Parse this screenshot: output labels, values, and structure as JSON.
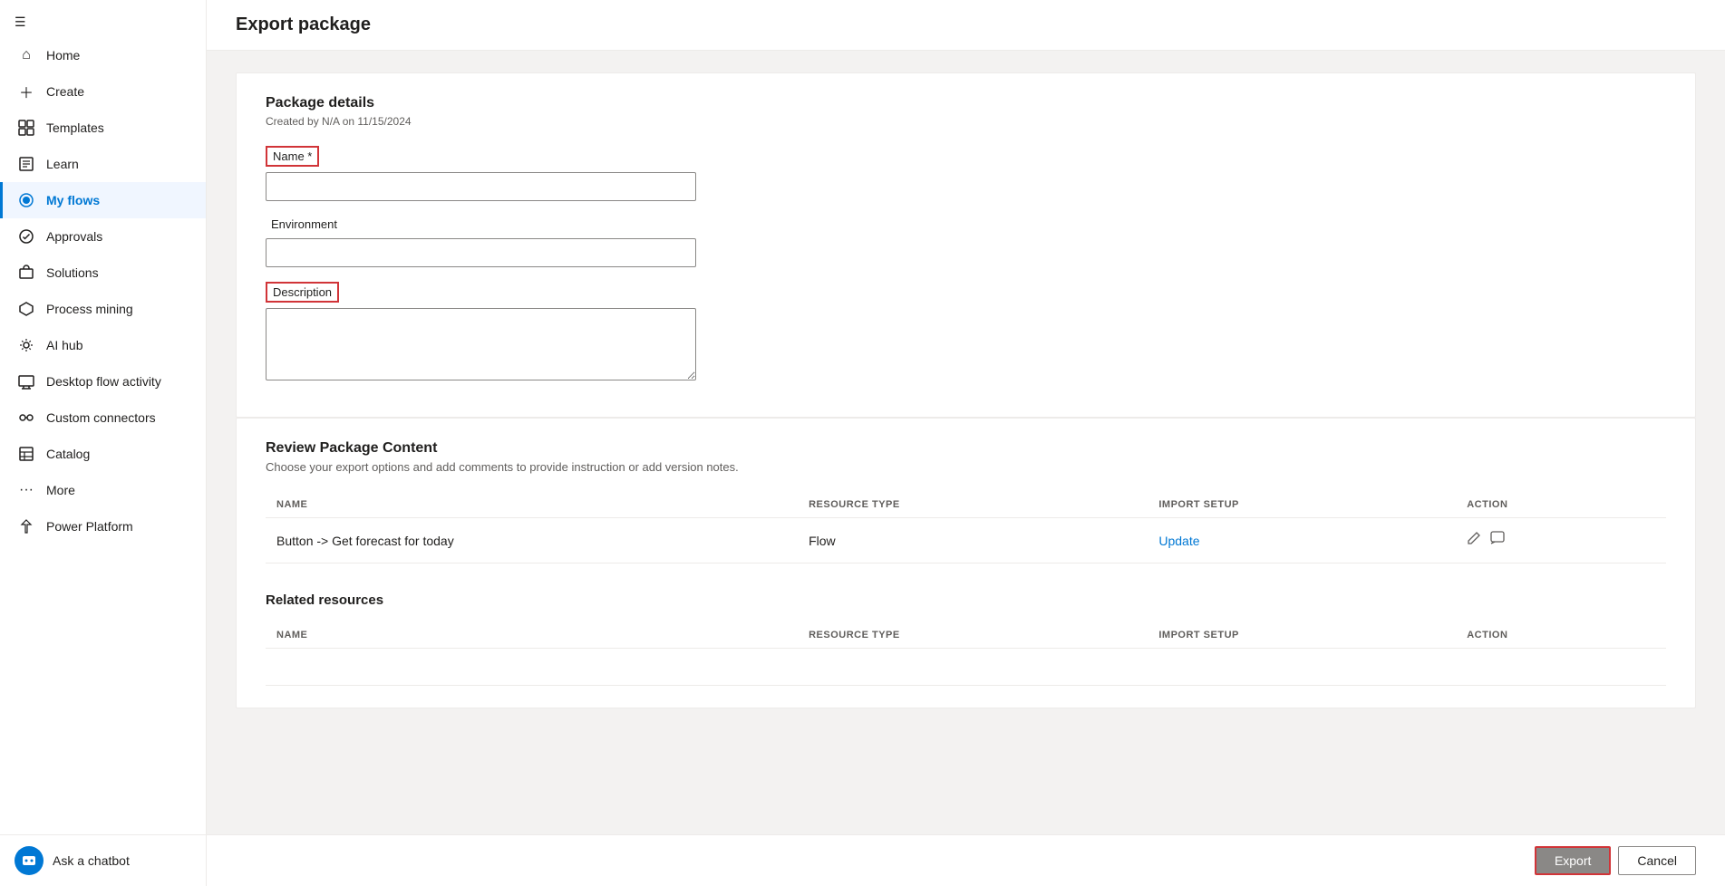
{
  "sidebar": {
    "hamburger_icon": "☰",
    "items": [
      {
        "id": "home",
        "label": "Home",
        "icon": "⌂",
        "active": false
      },
      {
        "id": "create",
        "label": "Create",
        "icon": "+",
        "active": false
      },
      {
        "id": "templates",
        "label": "Templates",
        "icon": "📄",
        "active": false
      },
      {
        "id": "learn",
        "label": "Learn",
        "icon": "📖",
        "active": false
      },
      {
        "id": "my-flows",
        "label": "My flows",
        "icon": "💧",
        "active": true
      },
      {
        "id": "approvals",
        "label": "Approvals",
        "icon": "✅",
        "active": false
      },
      {
        "id": "solutions",
        "label": "Solutions",
        "icon": "🧩",
        "active": false
      },
      {
        "id": "process-mining",
        "label": "Process mining",
        "icon": "⬡",
        "active": false
      },
      {
        "id": "ai-hub",
        "label": "AI hub",
        "icon": "🤖",
        "active": false
      },
      {
        "id": "desktop-flow-activity",
        "label": "Desktop flow activity",
        "icon": "🖥",
        "active": false
      },
      {
        "id": "custom-connectors",
        "label": "Custom connectors",
        "icon": "🔌",
        "active": false
      },
      {
        "id": "catalog",
        "label": "Catalog",
        "icon": "📚",
        "active": false
      },
      {
        "id": "more",
        "label": "More",
        "icon": "···",
        "active": false
      },
      {
        "id": "power-platform",
        "label": "Power Platform",
        "icon": "⚡",
        "active": false
      }
    ],
    "chatbot_label": "Ask a chatbot",
    "chatbot_icon": "💬"
  },
  "page": {
    "title": "Export package"
  },
  "package_details": {
    "section_title": "Package details",
    "subtitle": "Created by N/A on 11/15/2024",
    "name_label": "Name *",
    "name_placeholder": "",
    "name_value": "",
    "environment_label": "Environment",
    "environment_placeholder": "",
    "environment_value": "",
    "description_label": "Description",
    "description_placeholder": "",
    "description_value": ""
  },
  "review_package": {
    "section_title": "Review Package Content",
    "description": "Choose your export options and add comments to provide instruction or add version notes.",
    "table_headers": {
      "name": "NAME",
      "resource_type": "RESOURCE TYPE",
      "import_setup": "IMPORT SETUP",
      "action": "ACTION"
    },
    "rows": [
      {
        "name": "Button -> Get forecast for today",
        "resource_type": "Flow",
        "import_setup": "Update",
        "import_setup_is_link": true
      }
    ]
  },
  "related_resources": {
    "section_title": "Related resources",
    "table_headers": {
      "name": "NAME",
      "resource_type": "RESOURCE TYPE",
      "import_setup": "IMPORT SETUP",
      "action": "ACTION"
    }
  },
  "buttons": {
    "export_label": "Export",
    "cancel_label": "Cancel"
  }
}
